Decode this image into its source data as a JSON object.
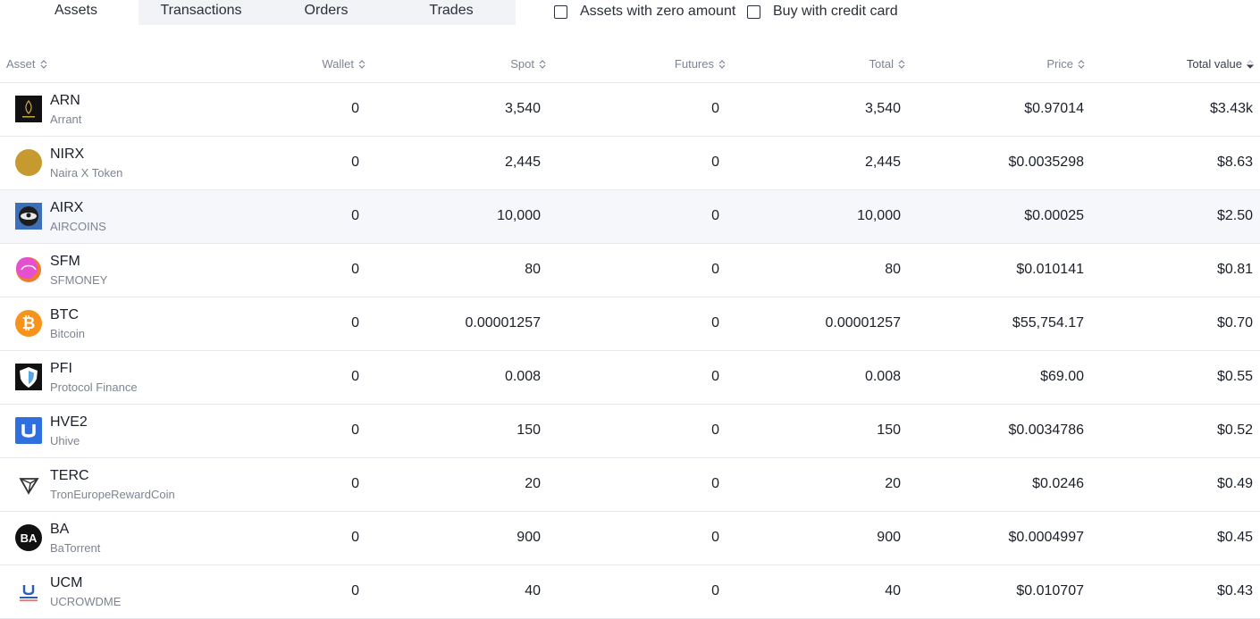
{
  "tabs": [
    {
      "label": "Assets",
      "active": true
    },
    {
      "label": "Transactions",
      "active": false
    },
    {
      "label": "Orders",
      "active": false
    },
    {
      "label": "Trades",
      "active": false
    }
  ],
  "filters": [
    {
      "label": "Assets with zero amount",
      "checked": false
    },
    {
      "label": "Buy with credit card",
      "checked": false
    }
  ],
  "columns": [
    "Asset",
    "Wallet",
    "Spot",
    "Futures",
    "Total",
    "Price",
    "Total value"
  ],
  "rows": [
    {
      "symbol": "ARN",
      "name": "Arrant",
      "icon": "arrant-logo-icon",
      "wallet": "0",
      "spot": "3,540",
      "futures": "0",
      "total": "3,540",
      "price": "$0.97014",
      "value": "$3.43k"
    },
    {
      "symbol": "NIRX",
      "name": "Naira X Token",
      "icon": "nairax-logo-icon",
      "wallet": "0",
      "spot": "2,445",
      "futures": "0",
      "total": "2,445",
      "price": "$0.0035298",
      "value": "$8.63"
    },
    {
      "symbol": "AIRX",
      "name": "AIRCOINS",
      "icon": "aircoins-logo-icon",
      "wallet": "0",
      "spot": "10,000",
      "futures": "0",
      "total": "10,000",
      "price": "$0.00025",
      "value": "$2.50"
    },
    {
      "symbol": "SFM",
      "name": "SFMONEY",
      "icon": "sfmoney-logo-icon",
      "wallet": "0",
      "spot": "80",
      "futures": "0",
      "total": "80",
      "price": "$0.010141",
      "value": "$0.81"
    },
    {
      "symbol": "BTC",
      "name": "Bitcoin",
      "icon": "bitcoin-logo-icon",
      "wallet": "0",
      "spot": "0.00001257",
      "futures": "0",
      "total": "0.00001257",
      "price": "$55,754.17",
      "value": "$0.70"
    },
    {
      "symbol": "PFI",
      "name": "Protocol Finance",
      "icon": "protocol-finance-logo-icon",
      "wallet": "0",
      "spot": "0.008",
      "futures": "0",
      "total": "0.008",
      "price": "$69.00",
      "value": "$0.55"
    },
    {
      "symbol": "HVE2",
      "name": "Uhive",
      "icon": "uhive-logo-icon",
      "wallet": "0",
      "spot": "150",
      "futures": "0",
      "total": "150",
      "price": "$0.0034786",
      "value": "$0.52"
    },
    {
      "symbol": "TERC",
      "name": "TronEuropeRewardCoin",
      "icon": "terc-logo-icon",
      "wallet": "0",
      "spot": "20",
      "futures": "0",
      "total": "20",
      "price": "$0.0246",
      "value": "$0.49"
    },
    {
      "symbol": "BA",
      "name": "BaTorrent",
      "icon": "batorrent-logo-icon",
      "wallet": "0",
      "spot": "900",
      "futures": "0",
      "total": "900",
      "price": "$0.0004997",
      "value": "$0.45"
    },
    {
      "symbol": "UCM",
      "name": "UCROWDME",
      "icon": "ucrowdme-logo-icon",
      "wallet": "0",
      "spot": "40",
      "futures": "0",
      "total": "40",
      "price": "$0.010707",
      "value": "$0.43"
    }
  ],
  "colors": {
    "text": "#1b1f2a",
    "muted": "#7c8494",
    "border": "#e7e9ee",
    "tab_bg": "#f1f3f6",
    "bitcoin": "#f7931a",
    "uhive": "#2f6fe0",
    "nairax": "#c69a2e"
  },
  "icon_text": {
    "bitcoin": "₿",
    "batorrent": "BA"
  }
}
